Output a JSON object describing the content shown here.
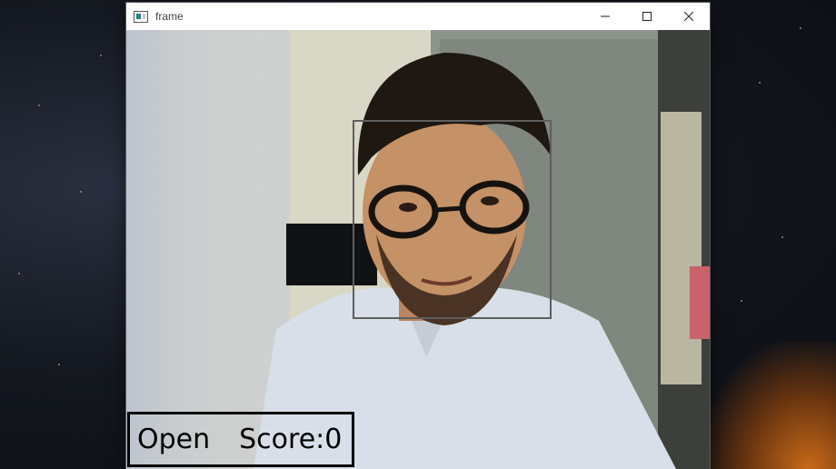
{
  "window": {
    "title": "frame",
    "controls": {
      "minimize": "minimize-icon",
      "maximize": "maximize-icon",
      "close": "close-icon"
    }
  },
  "overlay": {
    "state_label": "Open",
    "score_label": "Score:0"
  },
  "colors": {
    "face_box": "#5f5f5f",
    "status_box_border": "#000000",
    "status_text": "#000000"
  }
}
